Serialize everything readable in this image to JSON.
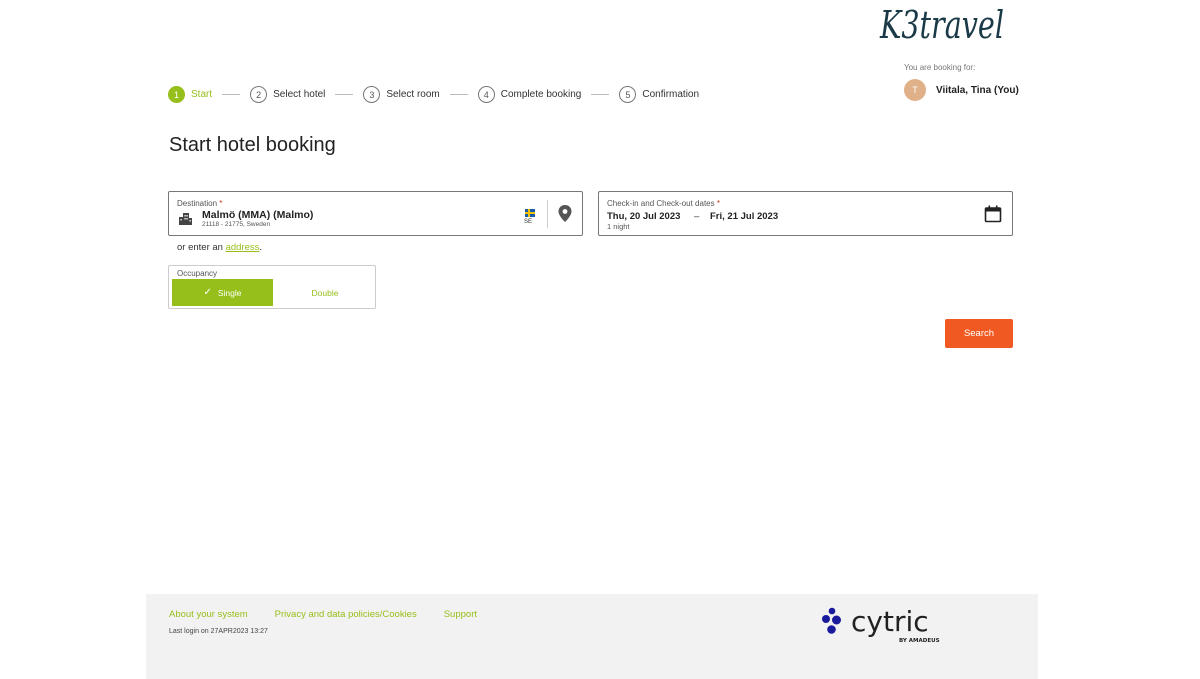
{
  "brand": {
    "logo_text": "K3travel"
  },
  "booking_for": {
    "label": "You are booking for:",
    "avatar_initial": "T",
    "user_name": "Viitala, Tina (You)"
  },
  "steps": [
    {
      "num": "1",
      "label": "Start",
      "active": true
    },
    {
      "num": "2",
      "label": "Select hotel"
    },
    {
      "num": "3",
      "label": "Select room"
    },
    {
      "num": "4",
      "label": "Complete booking"
    },
    {
      "num": "5",
      "label": "Confirmation"
    }
  ],
  "page_title": "Start hotel booking",
  "destination": {
    "label": "Destination",
    "required_mark": "*",
    "value": "Malmö (MMA) (Malmo)",
    "subtext": "21118 - 21775, Sweden",
    "country_code": "SE"
  },
  "alt_address": {
    "prefix": "or enter an",
    "link": "address",
    "suffix": "."
  },
  "dates": {
    "label": "Check-in and Check-out dates",
    "required_mark": "*",
    "check_in": "Thu, 20 Jul 2023",
    "separator": "–",
    "check_out": "Fri, 21 Jul 2023",
    "nights": "1 night"
  },
  "occupancy": {
    "label": "Occupancy",
    "options": [
      "Single",
      "Double"
    ],
    "selected": "Single"
  },
  "search_label": "Search",
  "footer": {
    "links": [
      "About your system",
      "Privacy and data policies/Cookies",
      "Support"
    ],
    "last_login": "Last login on 27APR2023 13:27",
    "cytric_text": "cytric",
    "cytric_sub": "BY AMADEUS"
  },
  "colors": {
    "accent_green": "#97bf1b",
    "search_orange": "#f05a22",
    "logo_teal": "#1b3a48",
    "cytric_blue": "#1a1a9c"
  }
}
